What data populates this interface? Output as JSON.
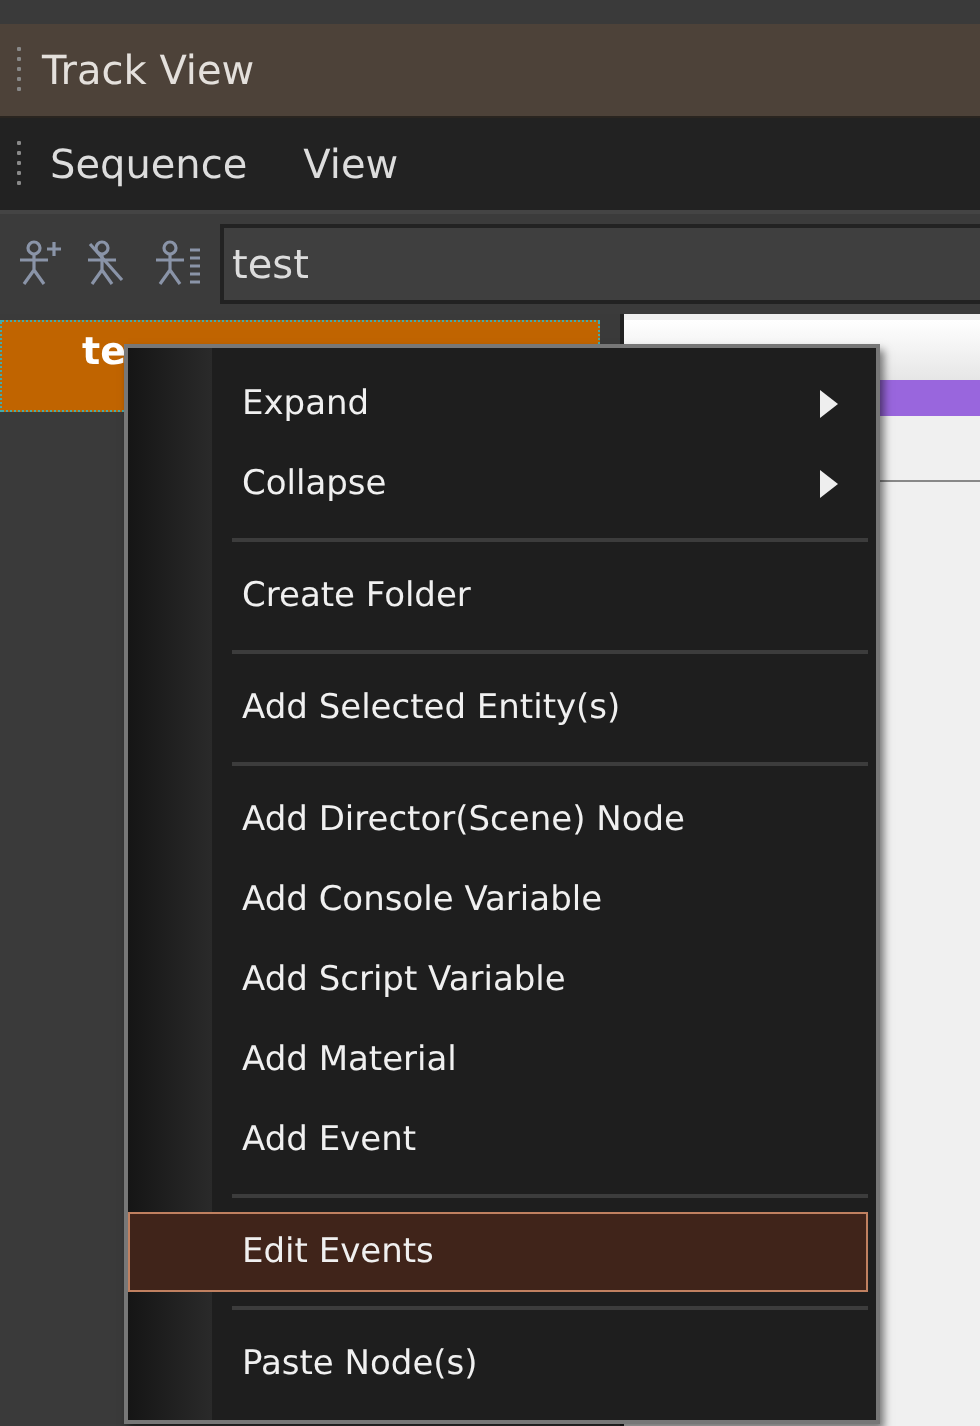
{
  "window": {
    "title": "Track View"
  },
  "menu_bar": [
    "Sequence",
    "View"
  ],
  "toolbar": {
    "search": {
      "value": "test"
    }
  },
  "tree": {
    "items": [
      {
        "label": "te",
        "selected": true
      }
    ]
  },
  "context_menu": {
    "items": [
      {
        "kind": "item",
        "label": "Expand",
        "submenu": true,
        "selected": false
      },
      {
        "kind": "item",
        "label": "Collapse",
        "submenu": true,
        "selected": false
      },
      {
        "kind": "separator"
      },
      {
        "kind": "item",
        "label": "Create Folder",
        "submenu": false,
        "selected": false
      },
      {
        "kind": "separator"
      },
      {
        "kind": "item",
        "label": "Add Selected Entity(s)",
        "submenu": false,
        "selected": false
      },
      {
        "kind": "separator"
      },
      {
        "kind": "item",
        "label": "Add Director(Scene) Node",
        "submenu": false,
        "selected": false
      },
      {
        "kind": "item",
        "label": "Add Console Variable",
        "submenu": false,
        "selected": false
      },
      {
        "kind": "item",
        "label": "Add Script Variable",
        "submenu": false,
        "selected": false
      },
      {
        "kind": "item",
        "label": "Add Material",
        "submenu": false,
        "selected": false
      },
      {
        "kind": "item",
        "label": "Add Event",
        "submenu": false,
        "selected": false
      },
      {
        "kind": "separator"
      },
      {
        "kind": "item",
        "label": "Edit Events",
        "submenu": false,
        "selected": true
      },
      {
        "kind": "separator"
      },
      {
        "kind": "item",
        "label": "Paste Node(s)",
        "submenu": false,
        "selected": false
      }
    ]
  }
}
